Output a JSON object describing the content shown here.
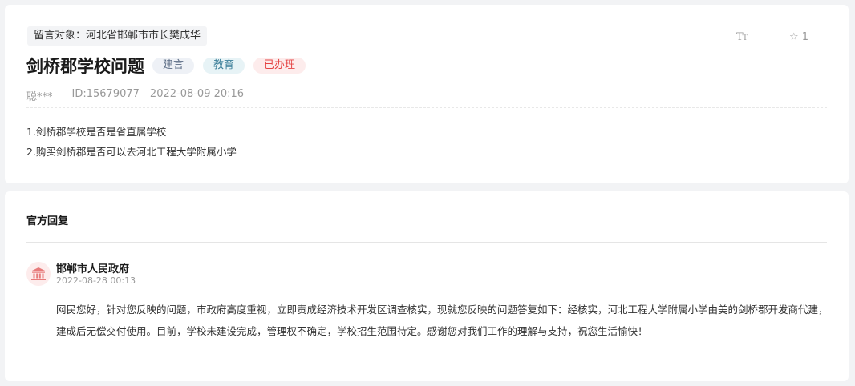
{
  "post": {
    "target": "留言对象：河北省邯郸市市长樊成华",
    "title": "剑桥郡学校问题",
    "tags": [
      "建言",
      "教育"
    ],
    "status": "已办理",
    "author": "聪***",
    "id": "ID:15679077",
    "datetime": "2022-08-09 20:16",
    "content_lines": [
      "1.剑桥郡学校是否是省直属学校",
      "2.购买剑桥郡是否可以去河北工程大学附属小学"
    ]
  },
  "toolbar": {
    "font_icon": "Tт",
    "favorite_count": "1"
  },
  "reply": {
    "section_title": "官方回复",
    "org_name": "邯郸市人民政府",
    "time": "2022-08-28 00:13",
    "body": "网民您好，针对您反映的问题，市政府高度重视，立即责成经济技术开发区调查核实，现就您反映的问题答复如下：经核实，河北工程大学附属小学由美的剑桥郡开发商代建，建成后无偿交付使用。目前，学校未建设完成，管理权不确定，学校招生范围待定。感谢您对我们工作的理解与支持，祝您生活愉快！"
  },
  "icons": {
    "font_size": "font-size-icon",
    "favorite": "star-outline-icon",
    "org_avatar": "government-building-icon"
  },
  "colors": {
    "status_done": "#e54545",
    "tag_jianyan": "#5a6b84",
    "tag_jiaoyu": "#3c7f99",
    "avatar_bg": "#fdecec",
    "avatar_icon": "#e77b7b"
  }
}
